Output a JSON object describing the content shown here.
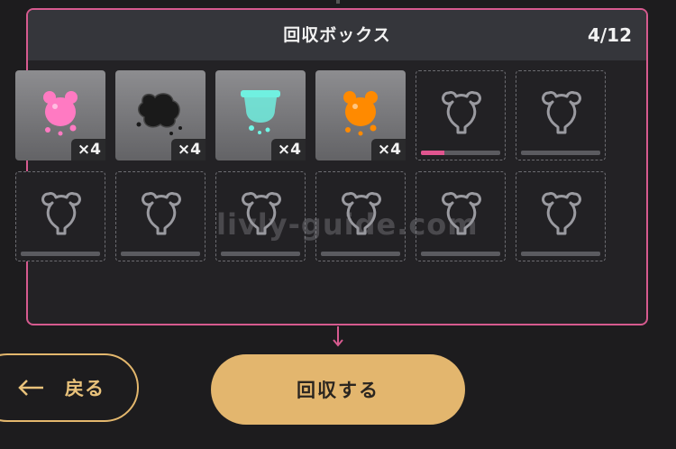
{
  "box": {
    "title": "回収ボックス",
    "count": "4/12"
  },
  "slots": [
    {
      "state": "filled",
      "item": "pink-bear-jelly-icon",
      "color": "#ff7ac2",
      "qty": "×4"
    },
    {
      "state": "filled",
      "item": "black-blob-jelly-icon",
      "color": "#1a1a1a",
      "qty": "×4"
    },
    {
      "state": "filled",
      "item": "cyan-drip-jelly-icon",
      "color": "#6ff5e5",
      "qty": "×4"
    },
    {
      "state": "filled",
      "item": "orange-bear-jelly-icon",
      "color": "#ff8a00",
      "qty": "×4"
    },
    {
      "state": "empty",
      "progress": 0.3
    },
    {
      "state": "empty",
      "progress": 0
    },
    {
      "state": "empty",
      "progress": 0
    },
    {
      "state": "empty",
      "progress": 0
    },
    {
      "state": "empty",
      "progress": 0
    },
    {
      "state": "empty",
      "progress": 0
    },
    {
      "state": "empty",
      "progress": 0
    },
    {
      "state": "empty",
      "progress": 0
    }
  ],
  "watermark": "livly-guide.com",
  "buttons": {
    "back_label": "戻る",
    "collect_label": "回収する"
  },
  "colors": {
    "accent_pink": "#d65a8f",
    "gold": "#e3b66e"
  }
}
